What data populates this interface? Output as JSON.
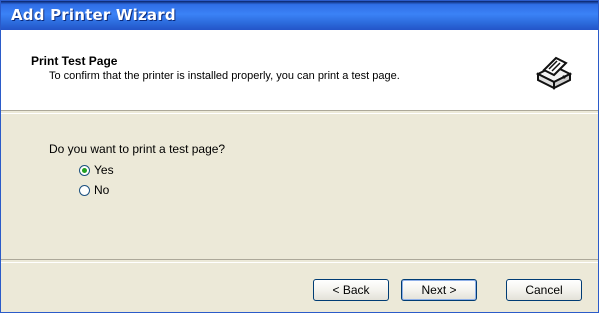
{
  "window": {
    "title": "Add Printer Wizard"
  },
  "header": {
    "title": "Print Test Page",
    "subtitle": "To confirm that the printer is installed properly, you can print a test page.",
    "icon": "printer-icon"
  },
  "question": "Do you want to print a test page?",
  "options": [
    {
      "label": "Yes",
      "selected": true
    },
    {
      "label": "No",
      "selected": false
    }
  ],
  "buttons": {
    "back": "< Back",
    "next": "Next >",
    "cancel": "Cancel"
  },
  "colors": {
    "titlebar": "#2f6ee6",
    "dialog_bg": "#ece9d8",
    "radio_selected": "#21a121"
  }
}
